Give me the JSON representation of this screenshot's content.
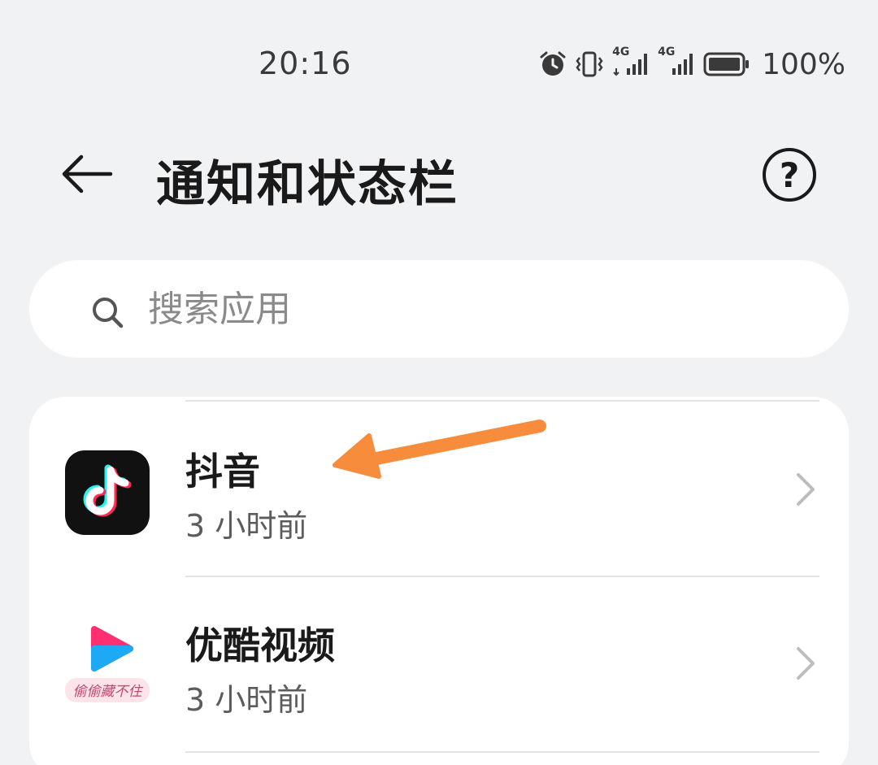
{
  "status_bar": {
    "time": "20:16",
    "network_1": "4G",
    "network_2": "4G",
    "battery": "100%"
  },
  "header": {
    "title": "通知和状态栏",
    "help_glyph": "?"
  },
  "search": {
    "placeholder": "搜索应用"
  },
  "apps": [
    {
      "name": "抖音",
      "subtitle": "3 小时前",
      "icon": "douyin-logo"
    },
    {
      "name": "优酷视频",
      "subtitle": "3 小时前",
      "icon": "youku-logo",
      "icon_caption": "偷偷藏不住"
    }
  ],
  "colors": {
    "background": "#f1f2f4",
    "annotation_arrow": "#f78c3c",
    "douyin_cyan": "#25f4ee",
    "douyin_red": "#fe2c55"
  }
}
